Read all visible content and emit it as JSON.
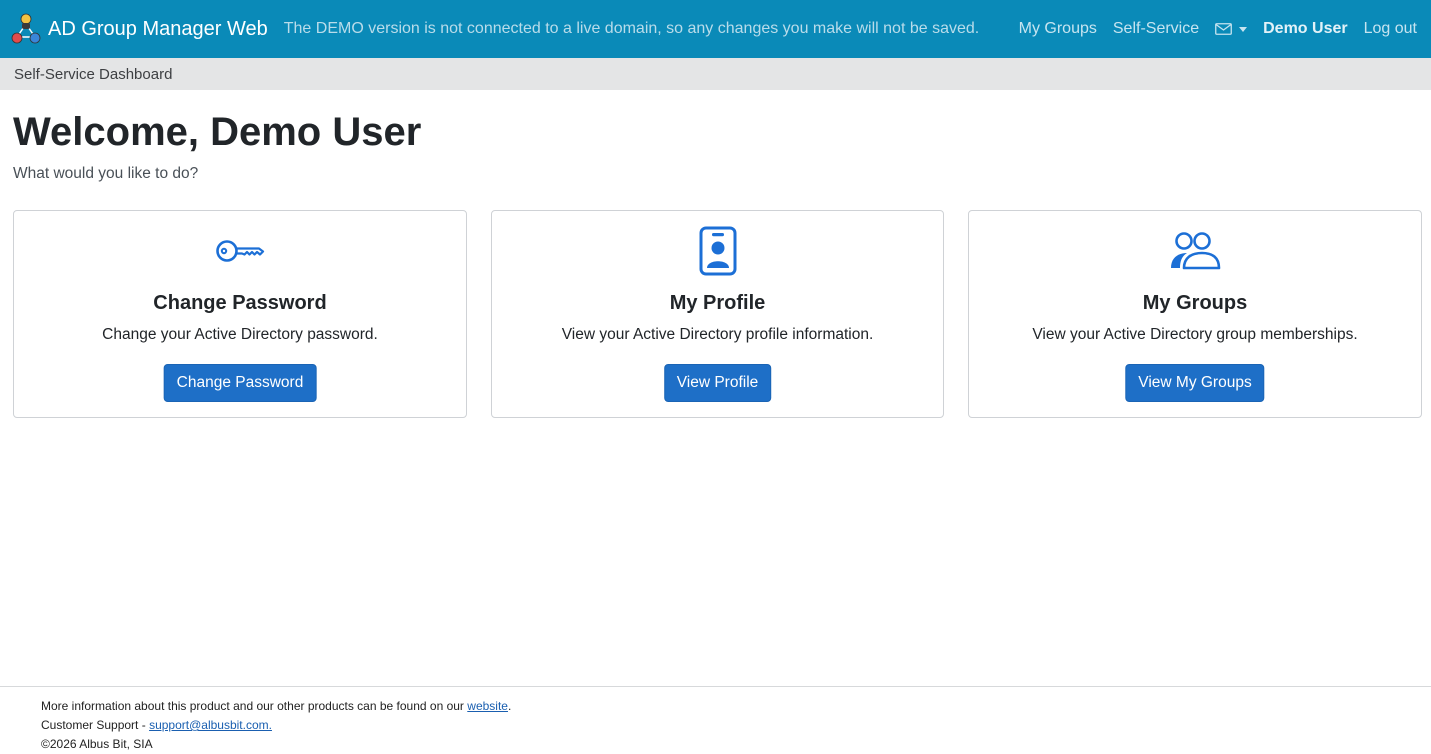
{
  "navbar": {
    "brand_name": "AD Group Manager Web",
    "demo_notice": "The DEMO version is not connected to a live domain, so any changes you make will not be saved.",
    "links": {
      "my_groups": "My Groups",
      "self_service": "Self-Service",
      "user": "Demo User",
      "logout": "Log out"
    },
    "icons": {
      "messages": "envelope-icon",
      "dropdown": "caret-down-icon",
      "logo": "group-network-logo"
    }
  },
  "breadcrumb": {
    "current": "Self-Service Dashboard"
  },
  "main": {
    "title": "Welcome, Demo User",
    "subtitle": "What would you like to do?",
    "cards": [
      {
        "icon": "key-icon",
        "title": "Change Password",
        "text": "Change your Active Directory password.",
        "button": "Change Password"
      },
      {
        "icon": "person-badge-icon",
        "title": "My Profile",
        "text": "View your Active Directory profile information.",
        "button": "View Profile"
      },
      {
        "icon": "people-icon",
        "title": "My Groups",
        "text": "View your Active Directory group memberships.",
        "button": "View My Groups"
      }
    ]
  },
  "footer": {
    "line1_prefix": "More information about this product and our other products can be found on our",
    "line1_link": "website",
    "line1_suffix": ".",
    "line2_prefix": "Customer Support -",
    "line2_link": "support@albusbit.com.",
    "line3": "©2026 Albus Bit, SIA"
  },
  "colors": {
    "navbar_bg": "#0a8ab8",
    "breadcrumb_bg": "#e4e5e6",
    "primary_button": "#1e6fc7",
    "icon_blue": "#1c6fd6"
  }
}
